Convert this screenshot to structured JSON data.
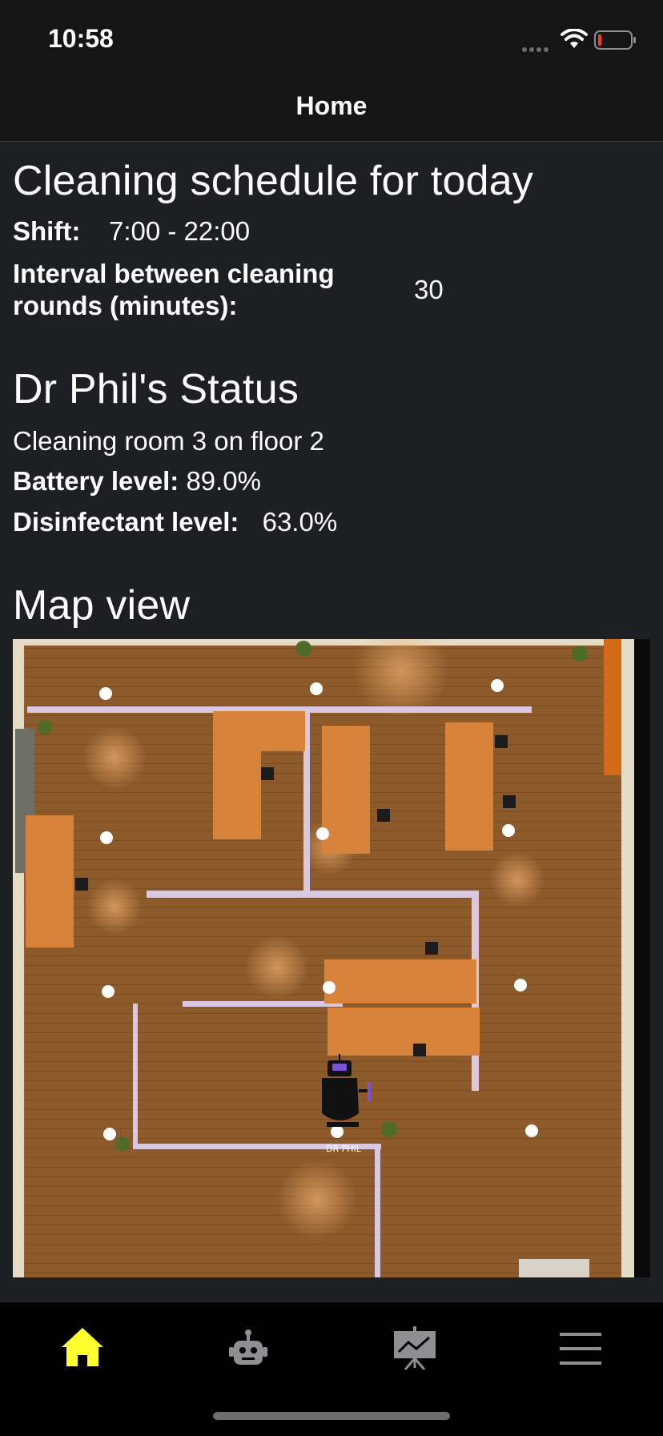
{
  "status_bar": {
    "time": "10:58"
  },
  "header": {
    "title": "Home"
  },
  "schedule": {
    "title": "Cleaning schedule for today",
    "shift_label": "Shift:",
    "shift_value": "7:00 - 22:00",
    "interval_label_line1": "Interval between cleaning",
    "interval_label_line2": "rounds (minutes):",
    "interval_value": "30"
  },
  "robot_status": {
    "title": "Dr Phil's Status",
    "activity": "Cleaning room 3 on floor 2",
    "battery_label": "Battery level:",
    "battery_value": "89.0%",
    "disinfectant_label": "Disinfectant level:",
    "disinfectant_value": "63.0%"
  },
  "map": {
    "title": "Map view",
    "robot_label": "DR PHIL"
  },
  "tabbar": {
    "active_color": "#ffff2e",
    "inactive_color": "#8e8e93",
    "tabs": [
      "home-icon",
      "robot-icon",
      "chart-icon",
      "menu-icon"
    ]
  }
}
